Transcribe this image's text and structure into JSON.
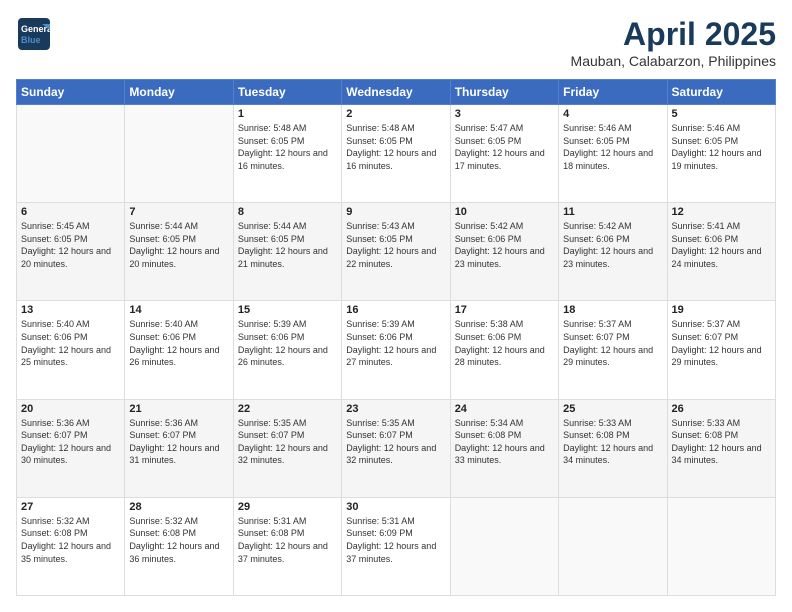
{
  "logo": {
    "line1": "General",
    "line2": "Blue"
  },
  "title": "April 2025",
  "subtitle": "Mauban, Calabarzon, Philippines",
  "days_of_week": [
    "Sunday",
    "Monday",
    "Tuesday",
    "Wednesday",
    "Thursday",
    "Friday",
    "Saturday"
  ],
  "weeks": [
    [
      {
        "day": "",
        "info": ""
      },
      {
        "day": "",
        "info": ""
      },
      {
        "day": "1",
        "info": "Sunrise: 5:48 AM\nSunset: 6:05 PM\nDaylight: 12 hours and 16 minutes."
      },
      {
        "day": "2",
        "info": "Sunrise: 5:48 AM\nSunset: 6:05 PM\nDaylight: 12 hours and 16 minutes."
      },
      {
        "day": "3",
        "info": "Sunrise: 5:47 AM\nSunset: 6:05 PM\nDaylight: 12 hours and 17 minutes."
      },
      {
        "day": "4",
        "info": "Sunrise: 5:46 AM\nSunset: 6:05 PM\nDaylight: 12 hours and 18 minutes."
      },
      {
        "day": "5",
        "info": "Sunrise: 5:46 AM\nSunset: 6:05 PM\nDaylight: 12 hours and 19 minutes."
      }
    ],
    [
      {
        "day": "6",
        "info": "Sunrise: 5:45 AM\nSunset: 6:05 PM\nDaylight: 12 hours and 20 minutes."
      },
      {
        "day": "7",
        "info": "Sunrise: 5:44 AM\nSunset: 6:05 PM\nDaylight: 12 hours and 20 minutes."
      },
      {
        "day": "8",
        "info": "Sunrise: 5:44 AM\nSunset: 6:05 PM\nDaylight: 12 hours and 21 minutes."
      },
      {
        "day": "9",
        "info": "Sunrise: 5:43 AM\nSunset: 6:05 PM\nDaylight: 12 hours and 22 minutes."
      },
      {
        "day": "10",
        "info": "Sunrise: 5:42 AM\nSunset: 6:06 PM\nDaylight: 12 hours and 23 minutes."
      },
      {
        "day": "11",
        "info": "Sunrise: 5:42 AM\nSunset: 6:06 PM\nDaylight: 12 hours and 23 minutes."
      },
      {
        "day": "12",
        "info": "Sunrise: 5:41 AM\nSunset: 6:06 PM\nDaylight: 12 hours and 24 minutes."
      }
    ],
    [
      {
        "day": "13",
        "info": "Sunrise: 5:40 AM\nSunset: 6:06 PM\nDaylight: 12 hours and 25 minutes."
      },
      {
        "day": "14",
        "info": "Sunrise: 5:40 AM\nSunset: 6:06 PM\nDaylight: 12 hours and 26 minutes."
      },
      {
        "day": "15",
        "info": "Sunrise: 5:39 AM\nSunset: 6:06 PM\nDaylight: 12 hours and 26 minutes."
      },
      {
        "day": "16",
        "info": "Sunrise: 5:39 AM\nSunset: 6:06 PM\nDaylight: 12 hours and 27 minutes."
      },
      {
        "day": "17",
        "info": "Sunrise: 5:38 AM\nSunset: 6:06 PM\nDaylight: 12 hours and 28 minutes."
      },
      {
        "day": "18",
        "info": "Sunrise: 5:37 AM\nSunset: 6:07 PM\nDaylight: 12 hours and 29 minutes."
      },
      {
        "day": "19",
        "info": "Sunrise: 5:37 AM\nSunset: 6:07 PM\nDaylight: 12 hours and 29 minutes."
      }
    ],
    [
      {
        "day": "20",
        "info": "Sunrise: 5:36 AM\nSunset: 6:07 PM\nDaylight: 12 hours and 30 minutes."
      },
      {
        "day": "21",
        "info": "Sunrise: 5:36 AM\nSunset: 6:07 PM\nDaylight: 12 hours and 31 minutes."
      },
      {
        "day": "22",
        "info": "Sunrise: 5:35 AM\nSunset: 6:07 PM\nDaylight: 12 hours and 32 minutes."
      },
      {
        "day": "23",
        "info": "Sunrise: 5:35 AM\nSunset: 6:07 PM\nDaylight: 12 hours and 32 minutes."
      },
      {
        "day": "24",
        "info": "Sunrise: 5:34 AM\nSunset: 6:08 PM\nDaylight: 12 hours and 33 minutes."
      },
      {
        "day": "25",
        "info": "Sunrise: 5:33 AM\nSunset: 6:08 PM\nDaylight: 12 hours and 34 minutes."
      },
      {
        "day": "26",
        "info": "Sunrise: 5:33 AM\nSunset: 6:08 PM\nDaylight: 12 hours and 34 minutes."
      }
    ],
    [
      {
        "day": "27",
        "info": "Sunrise: 5:32 AM\nSunset: 6:08 PM\nDaylight: 12 hours and 35 minutes."
      },
      {
        "day": "28",
        "info": "Sunrise: 5:32 AM\nSunset: 6:08 PM\nDaylight: 12 hours and 36 minutes."
      },
      {
        "day": "29",
        "info": "Sunrise: 5:31 AM\nSunset: 6:08 PM\nDaylight: 12 hours and 37 minutes."
      },
      {
        "day": "30",
        "info": "Sunrise: 5:31 AM\nSunset: 6:09 PM\nDaylight: 12 hours and 37 minutes."
      },
      {
        "day": "",
        "info": ""
      },
      {
        "day": "",
        "info": ""
      },
      {
        "day": "",
        "info": ""
      }
    ]
  ]
}
